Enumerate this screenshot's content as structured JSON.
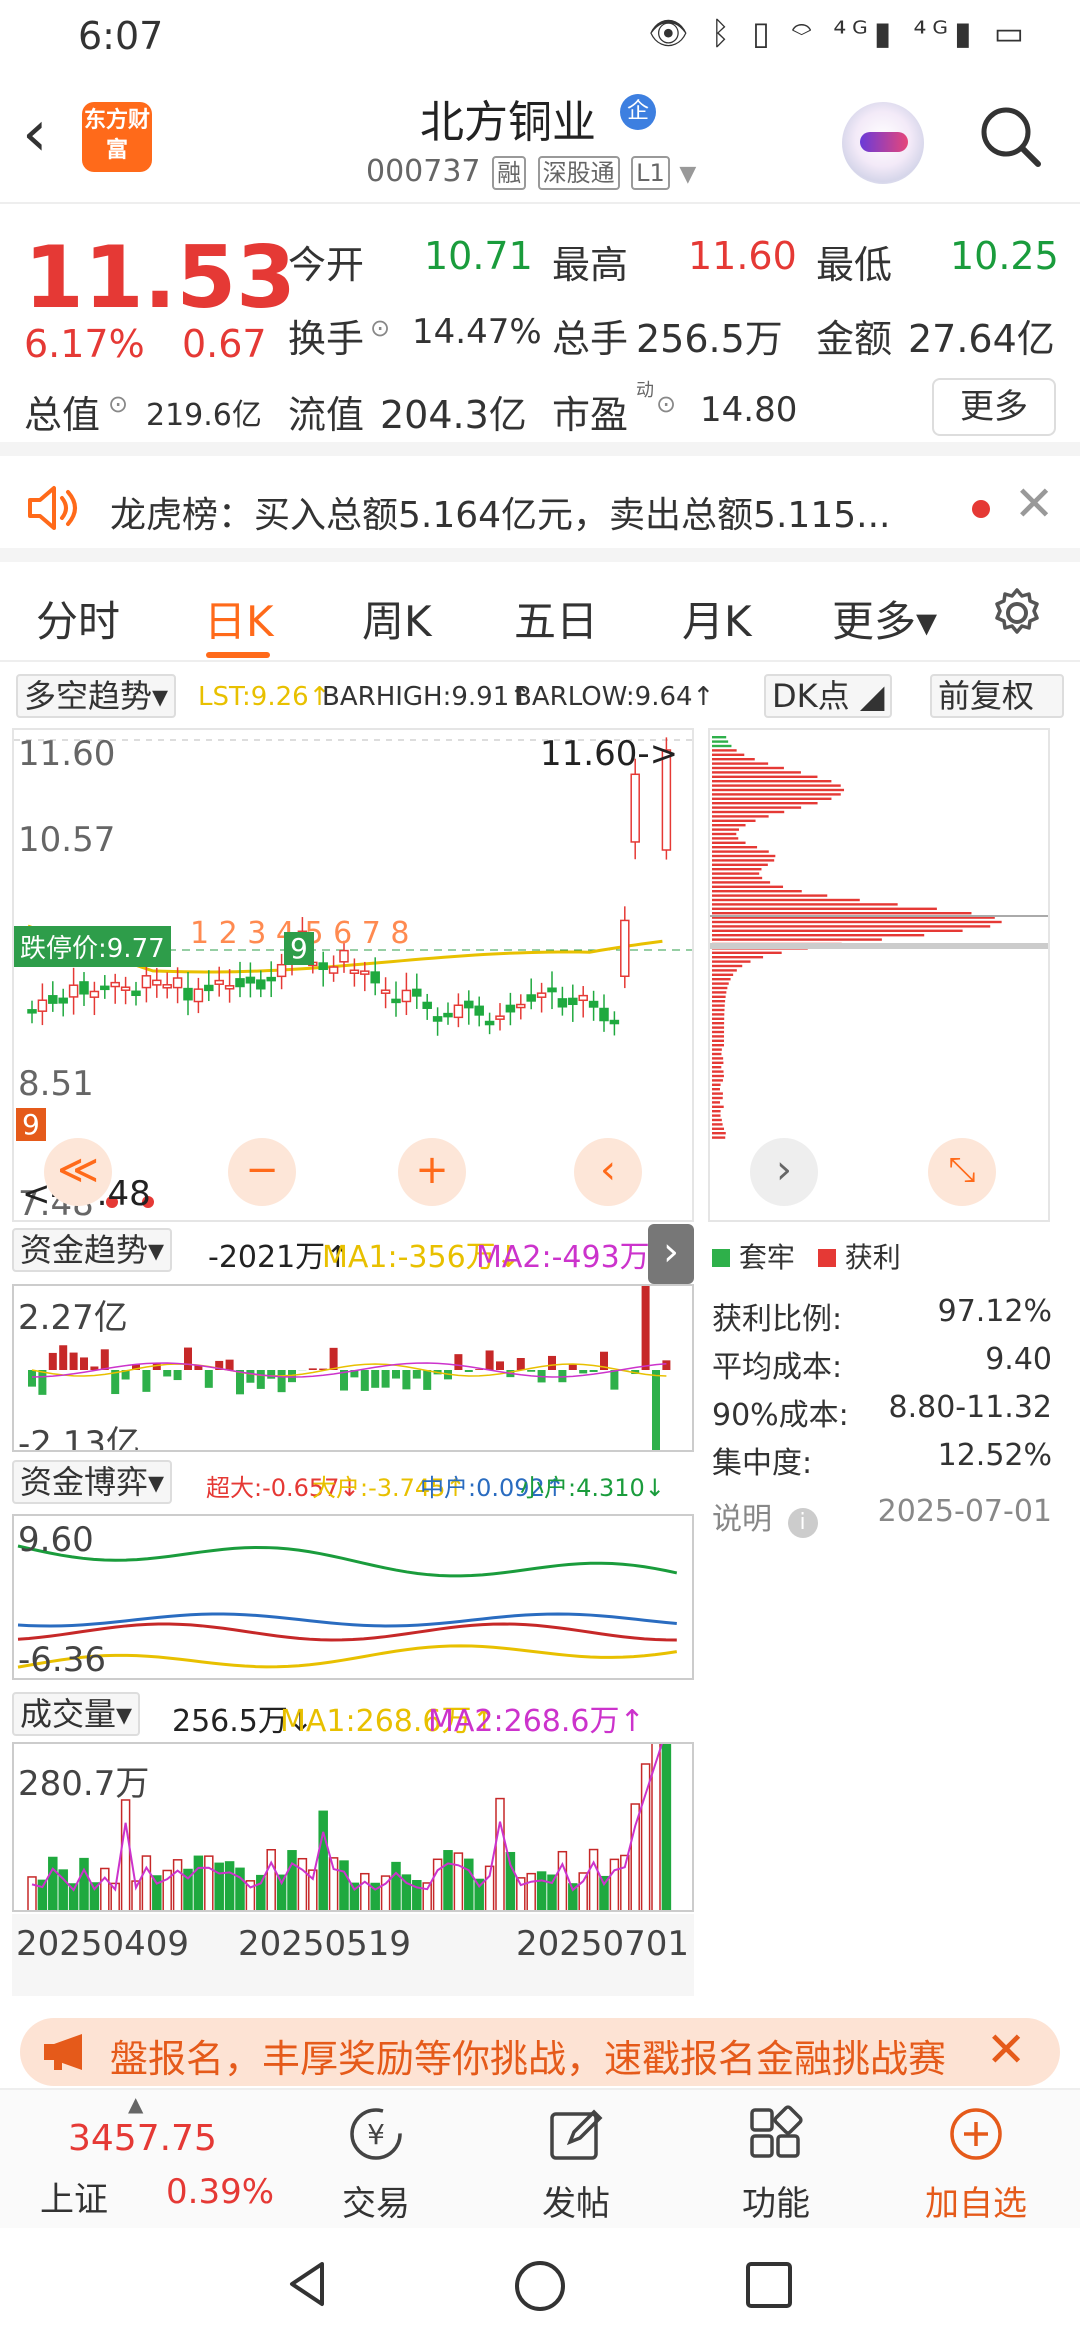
{
  "status": {
    "time": "6:07",
    "icons": "👁 ᛒ ▯ ⌔ ⁴ᴳ▮ ⁴ᴳ▮ ▭"
  },
  "header": {
    "back": "‹",
    "logo_text": "东方财富",
    "stock_name": "北方铜业",
    "badge": "企",
    "code": "000737",
    "tags": [
      "融",
      "深股通",
      "L1"
    ]
  },
  "quote": {
    "price": "11.53",
    "change_pct": "6.17%",
    "change": "0.67",
    "labels": {
      "open": "今开",
      "high": "最高",
      "low": "最低",
      "turnover": "换手",
      "volume": "总手",
      "amount": "金额",
      "total_mv": "总值",
      "float_mv": "流值",
      "pe": "市盈",
      "pe_sup": "动"
    },
    "values": {
      "open": "10.71",
      "high": "11.60",
      "low": "10.25",
      "turnover": "14.47%",
      "volume": "256.5万",
      "amount": "27.64亿",
      "total_mv": "219.6亿",
      "float_mv": "204.3亿",
      "pe": "14.80"
    },
    "more": "更多"
  },
  "notice": {
    "text": "龙虎榜：买入总额5.164亿元，卖出总额5.115..."
  },
  "tabs": [
    "分时",
    "日K",
    "周K",
    "五日",
    "月K",
    "更多▾"
  ],
  "kline": {
    "indicator": "多空趋势▾",
    "lst": "LST:9.26↑",
    "barhigh": "BARHIGH:9.91↑",
    "barlow": "BARLOW:9.64↑",
    "dk": "DK点",
    "adjust": "前复权",
    "y_top": "11.60",
    "y_mid": "10.57",
    "y_low": "8.51",
    "y_bottom": "7.48",
    "limit_down": "跌停价:9.77",
    "max_marker": "11.60->",
    "min_marker": "<--7.48",
    "mark_9": "9",
    "mark_seq": "1 2 3 4 5 6 7 8",
    "controls": [
      "≪",
      "−",
      "+",
      "‹"
    ]
  },
  "chip": {
    "controls": [
      "›",
      "⤡"
    ],
    "legend_lock": "套牢",
    "legend_profit": "获利",
    "rows": [
      {
        "label": "获利比例:",
        "value": "97.12%"
      },
      {
        "label": "平均成本:",
        "value": "9.40"
      },
      {
        "label": "90%成本:",
        "value": "8.80-11.32"
      },
      {
        "label": "集中度:",
        "value": "12.52%"
      }
    ],
    "note": "说明",
    "date": "2025-07-01"
  },
  "fund_trend": {
    "label": "资金趋势▾",
    "value": "-2021万↑",
    "ma1": "MA1:-356万↓",
    "ma2": "MA2:-493万↑",
    "y_top": "2.27亿",
    "y_bottom": "-2.13亿"
  },
  "fund_game": {
    "label": "资金博弈▾",
    "super": "超大:-0.657↓",
    "big": "大户:-3.745↑",
    "mid": "中户:0.092↑",
    "small": "小户:4.310↓",
    "y_top": "9.60",
    "y_bottom": "-6.36"
  },
  "volume": {
    "label": "成交量▾",
    "value": "256.5万↓",
    "ma1": "MA1:268.6万↑",
    "ma2": "MA2:268.6万↑",
    "y_top": "280.7万",
    "dates": [
      "20250409",
      "20250519",
      "20250701"
    ]
  },
  "banner": {
    "text": "盤报名，丰厚奖励等你挑战，速戳报名金融挑战赛"
  },
  "bottomnav": {
    "index_value": "3457.75",
    "index_name": "上证",
    "index_pct": "0.39%",
    "items": [
      "交易",
      "发帖",
      "功能",
      "加自选"
    ]
  },
  "colors": {
    "up": "#e53935",
    "down": "#1a9c3c",
    "accent": "#ff6a1a",
    "ma_yellow": "#e8c000",
    "ma_magenta": "#cc33cc"
  }
}
